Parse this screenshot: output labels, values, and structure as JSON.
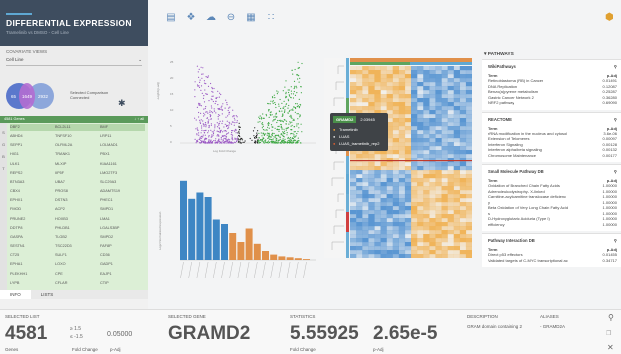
{
  "app": {
    "title": "DIFFERENTIAL EXPRESSION",
    "subtitle": "Tramelinib vs DMSO - Cell Line"
  },
  "covariate": {
    "heading": "COVARIATE VIEWS",
    "label": "Cell Line",
    "selected_comparison": "Selected Comparison",
    "connected": "Connected"
  },
  "venn": {
    "left": "65",
    "mid": "1649",
    "right": "2932",
    "colors": [
      "#4b6cc9",
      "#b36dd1",
      "#7c9bd8"
    ]
  },
  "genes": {
    "header_left": "4581 Genes",
    "header_right": "↓ ↑ all",
    "cells": [
      "DBF2",
      "BCL2L11",
      "BMF",
      "ABHD4",
      "TNFSF10",
      "LRP11",
      "SEPP1",
      "OLFML2A",
      "LOLMAD1",
      "HIG1",
      "TRANK1",
      "PBX1",
      "ULK1",
      "MLXIP",
      "KIAA1161",
      "REPS2",
      "IIP5F",
      "LMO2TF3",
      "BTN3A3",
      "UBA7",
      "SLC29A3",
      "CBX4",
      "PROS8",
      "ADAMTS19",
      "EPHX1",
      "DSTN3",
      "PHEC1",
      "FMOD",
      "ACP2",
      "SMPD1",
      "PRUNE2",
      "HOXB3",
      "LMA1",
      "DDTP8",
      "PHLDB1",
      "LGALS3BP",
      "GASPA",
      "TLGB2",
      "SMPD2",
      "SESTN1",
      "TSC22D3",
      "FAF8P",
      "CT25",
      "SULF1",
      "CD36",
      "EPHA1",
      "LOXO",
      "GADP1",
      "PLEKHH1",
      "CPE",
      "EAJP1",
      "LYPB",
      "CFLAR",
      "CTIP"
    ],
    "side_markers": [
      "S",
      "G",
      "B",
      "T"
    ]
  },
  "left_tabs": {
    "info": "INFO",
    "lists": "LISTS"
  },
  "toolbar": {
    "icons": [
      "document-icon",
      "label-icon",
      "cloud-upload-icon",
      "zoom-out-icon",
      "calendar-icon",
      "scatter-plot-icon"
    ]
  },
  "volcano": {
    "xlabel": "Log Fold Change",
    "ylabel": "-Log10(p-adj)",
    "yticks": [
      "25",
      "20",
      "15",
      "10",
      "5",
      "0"
    ]
  },
  "bars": {
    "ylabel": "Log2 Normalized Expression",
    "values": [
      88,
      68,
      75,
      70,
      45,
      40,
      30,
      20,
      35,
      18,
      10,
      6,
      4,
      3,
      2,
      1
    ],
    "colors": [
      "#3e86c4",
      "#3e86c4",
      "#3e86c4",
      "#3e86c4",
      "#3e86c4",
      "#3e86c4",
      "#e0904a",
      "#e0904a",
      "#e0904a",
      "#e0904a",
      "#e0904a",
      "#e0904a",
      "#e0904a",
      "#e0904a",
      "#e0904a",
      "#e0904a"
    ]
  },
  "tooltip": {
    "gene": "GRAMD2",
    "value": "2.03945",
    "items": [
      "Trametinib",
      "LUAS",
      "LUAS_trametinib_rep2"
    ]
  },
  "pathways": {
    "title": "PATHWAYS",
    "sections": [
      {
        "name": "WikiPathways",
        "cols": [
          "Term",
          "p-Adj"
        ],
        "rows": [
          [
            "Retinoblastoma (RB) in Cancer",
            "0.01491"
          ],
          [
            "DNA Replication",
            "0.12087"
          ],
          [
            "Benzo(a)pyrene metabolism",
            "0.25287"
          ],
          [
            "Gastric Cancer Network 2",
            "0.36280"
          ],
          [
            "NRF2 pathway",
            "0.69090"
          ]
        ]
      },
      {
        "name": "REACTOME",
        "cols": [
          "Term",
          "p-Adj"
        ],
        "rows": [
          [
            "rRNA modification in the nucleus and cytosol",
            "3.6e-06"
          ],
          [
            "Extension of Telomeres",
            "0.00097"
          ],
          [
            "Interferon Signaling",
            "0.00128"
          ],
          [
            "Interferon alpha/beta signaling",
            "0.00132"
          ],
          [
            "Chromosome Maintenance",
            "0.00177"
          ]
        ]
      },
      {
        "name": "Small Molecule Pathway DB",
        "cols": [
          "Term",
          "p-Adj"
        ],
        "rows": [
          [
            "Oxidation of Branched Chain Fatty Acids",
            "1.00000"
          ],
          [
            "Adrenoleukodystrophy- X-linked",
            "1.00000"
          ],
          [
            "Carnitine-acylcarnitine translocase deficienc",
            "1.00000"
          ],
          [
            "y",
            "1.00000"
          ],
          [
            "Beta Oxidation of Very Long Chain Fatty Acid",
            "1.00000"
          ],
          [
            "s",
            "1.00000"
          ],
          [
            "D-Hydroxyglutaric Aciduria (Type I)",
            "1.00000"
          ],
          [
            "efficiency",
            "1.00000"
          ]
        ]
      },
      {
        "name": "Pathway Interaction DB",
        "cols": [
          "Term",
          "p-Adj"
        ],
        "rows": [
          [
            "Direct p53 effectors",
            "0.01455"
          ],
          [
            "Validated targets of C-MYC transcriptional ac",
            "0.34717"
          ]
        ]
      }
    ]
  },
  "bottom": {
    "selected_list": "SELECTED LIST",
    "count": "4581",
    "up": "≥ 1.5",
    "down": "≤ -1.5",
    "padj": "0.05000",
    "genes_label": "Genes",
    "fc_label": "Fold Change",
    "padj_label": "p-Adj",
    "selected_gene": "SELECTED GENE",
    "gene": "GRAMD2",
    "statistics": "STATISTICS",
    "fc": "5.55925",
    "pv": "2.65e-5",
    "stat_fc_label": "Fold Change",
    "stat_p_label": "p-Adj",
    "description": "DESCRIPTION",
    "desc_value": "GRAM domain containing 2",
    "aliases": "ALIASES",
    "alias_value": "- GRAMD2A"
  }
}
